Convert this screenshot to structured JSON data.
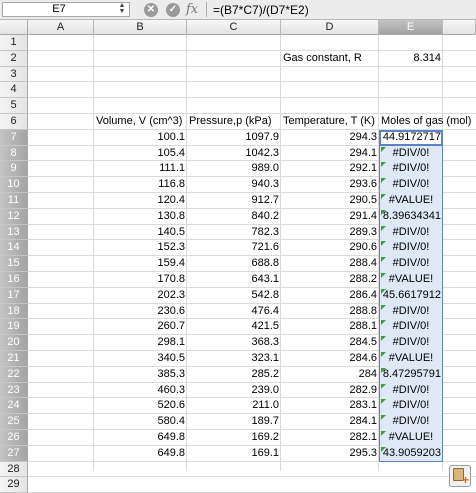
{
  "formula_bar": {
    "cell_ref": "E7",
    "formula": "=(B7*C7)/(D7*E2)",
    "fx_label": "fx",
    "cancel_glyph": "✕",
    "confirm_glyph": "✓"
  },
  "columns": [
    "A",
    "B",
    "C",
    "D",
    "E"
  ],
  "rows": [
    "1",
    "2",
    "3",
    "4",
    "5",
    "6",
    "7",
    "8",
    "9",
    "10",
    "11",
    "12",
    "13",
    "14",
    "15",
    "16",
    "17",
    "18",
    "19",
    "20",
    "21",
    "22",
    "23",
    "24",
    "25",
    "26",
    "27",
    "28",
    "29"
  ],
  "gas_constant": {
    "label": "Gas constant, R",
    "value": "8.314"
  },
  "table": {
    "headers": [
      "Volume, V (cm^3)",
      "Pressure,p (kPa)",
      "Temperature, T (K)",
      "Moles of gas (mol)"
    ],
    "rows": [
      [
        "100.1",
        "1097.9",
        "294.3",
        "44.9172717"
      ],
      [
        "105.4",
        "1042.3",
        "294.1",
        "#DIV/0!"
      ],
      [
        "111.1",
        "989.0",
        "292.1",
        "#DIV/0!"
      ],
      [
        "116.8",
        "940.3",
        "293.6",
        "#DIV/0!"
      ],
      [
        "120.4",
        "912.7",
        "290.5",
        "#VALUE!"
      ],
      [
        "130.8",
        "840.2",
        "291.4",
        "8.39634341"
      ],
      [
        "140.5",
        "782.3",
        "289.3",
        "#DIV/0!"
      ],
      [
        "152.3",
        "721.6",
        "290.6",
        "#DIV/0!"
      ],
      [
        "159.4",
        "688.8",
        "288.4",
        "#DIV/0!"
      ],
      [
        "170.8",
        "643.1",
        "288.2",
        "#VALUE!"
      ],
      [
        "202.3",
        "542.8",
        "286.4",
        "45.6617912"
      ],
      [
        "230.6",
        "476.4",
        "288.8",
        "#DIV/0!"
      ],
      [
        "260.7",
        "421.5",
        "288.1",
        "#DIV/0!"
      ],
      [
        "298.1",
        "368.3",
        "284.5",
        "#DIV/0!"
      ],
      [
        "340.5",
        "323.1",
        "284.6",
        "#VALUE!"
      ],
      [
        "385.3",
        "285.2",
        "284",
        "8.47295791"
      ],
      [
        "460.3",
        "239.0",
        "282.9",
        "#DIV/0!"
      ],
      [
        "520.6",
        "211.0",
        "283.1",
        "#DIV/0!"
      ],
      [
        "580.4",
        "189.7",
        "284.1",
        "#DIV/0!"
      ],
      [
        "649.8",
        "169.2",
        "282.1",
        "#VALUE!"
      ],
      [
        "649.8",
        "169.1",
        "295.3",
        "43.9059203"
      ]
    ]
  },
  "selection": {
    "active_cell": "E7",
    "range": "E7:E27"
  },
  "colors": {
    "selection_fill": "#dfe9f6",
    "selection_border": "#5c82c4",
    "error_marker": "#3aa13a"
  },
  "icons": {
    "cancel": "cancel-icon",
    "confirm": "confirm-icon",
    "paste_options": "paste-options-icon"
  }
}
